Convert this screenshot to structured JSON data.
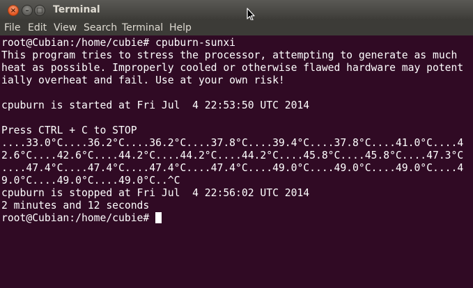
{
  "window": {
    "title": "Terminal",
    "close_glyph": "×",
    "min_glyph": "–",
    "max_glyph": "□"
  },
  "menubar": {
    "items": [
      "File",
      "Edit",
      "View",
      "Search",
      "Terminal",
      "Help"
    ]
  },
  "terminal": {
    "background": "#300a24",
    "foreground": "#ffffff",
    "lines": [
      "root@Cubian:/home/cubie# cpuburn-sunxi",
      "This program tries to stress the processor, attempting to generate as much",
      "heat as possible. Improperly cooled or otherwise flawed hardware may potent",
      "ially overheat and fail. Use at your own risk!",
      "",
      "cpuburn is started at Fri Jul  4 22:53:50 UTC 2014",
      "",
      "Press CTRL + C to STOP",
      "....33.0°C....36.2°C....36.2°C....37.8°C....39.4°C....37.8°C....41.0°C....4",
      "2.6°C....42.6°C....44.2°C....44.2°C....44.2°C....45.8°C....45.8°C....47.3°C",
      "....47.4°C....47.4°C....47.4°C....47.4°C....49.0°C....49.0°C....49.0°C....4",
      "9.0°C....49.0°C....49.0°C..^C",
      "cpuburn is stopped at Fri Jul  4 22:56:02 UTC 2014",
      "2 minutes and 12 seconds"
    ],
    "prompt": "root@Cubian:/home/cubie# "
  },
  "icons": {
    "close": "close-icon",
    "minimize": "minimize-icon",
    "maximize": "maximize-icon",
    "mouse_pointer": "mouse-pointer-icon"
  }
}
